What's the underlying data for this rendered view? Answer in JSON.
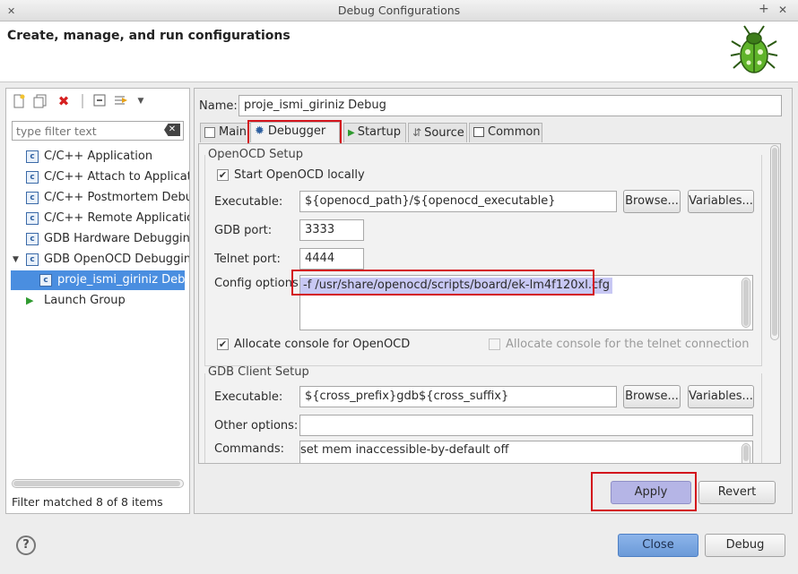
{
  "window": {
    "title": "Debug Configurations",
    "pin_glyph": "+",
    "close_glyph": "✕"
  },
  "header": {
    "title": "Create, manage, and run configurations"
  },
  "left": {
    "filter_placeholder": "type filter text",
    "tree": [
      {
        "label": "C/C++ Application"
      },
      {
        "label": "C/C++ Attach to Application"
      },
      {
        "label": "C/C++ Postmortem Debugger"
      },
      {
        "label": "C/C++ Remote Application"
      },
      {
        "label": "GDB Hardware Debugging"
      },
      {
        "label": "GDB OpenOCD Debugging"
      },
      {
        "label": "proje_ismi_giriniz Debug"
      },
      {
        "label": "Launch Group"
      }
    ],
    "filter_status": "Filter matched 8 of 8 items"
  },
  "config": {
    "name_label": "Name:",
    "name_value": "proje_ismi_giriniz Debug",
    "tabs": [
      {
        "label": "Main"
      },
      {
        "label": "Debugger"
      },
      {
        "label": "Startup"
      },
      {
        "label": "Source"
      },
      {
        "label": "Common"
      }
    ],
    "openocd": {
      "group_title": "OpenOCD Setup",
      "start_locally": "Start OpenOCD locally",
      "executable_label": "Executable:",
      "executable_value": "${openocd_path}/${openocd_executable}",
      "gdb_port_label": "GDB port:",
      "gdb_port_value": "3333",
      "telnet_port_label": "Telnet port:",
      "telnet_port_value": "4444",
      "config_label": "Config options:",
      "config_value": "-f /usr/share/openocd/scripts/board/ek-lm4f120xl.cfg",
      "allocate_console": "Allocate console for OpenOCD",
      "allocate_telnet": "Allocate console for the telnet connection"
    },
    "gdb_client": {
      "group_title": "GDB Client Setup",
      "executable_label": "Executable:",
      "executable_value": "${cross_prefix}gdb${cross_suffix}",
      "other_label": "Other options:",
      "other_value": "",
      "commands_label": "Commands:",
      "commands_value": "set mem inaccessible-by-default off"
    },
    "browse_label": "Browse...",
    "variables_label": "Variables...",
    "apply_label": "Apply",
    "revert_label": "Revert"
  },
  "footer": {
    "help_glyph": "?",
    "close_label": "Close",
    "debug_label": "Debug"
  },
  "colors": {
    "selection": "#4a8ee0",
    "highlight_text": "#c8c8f4",
    "annotation": "#d3141c",
    "apply_button": "#b5b5e6"
  }
}
